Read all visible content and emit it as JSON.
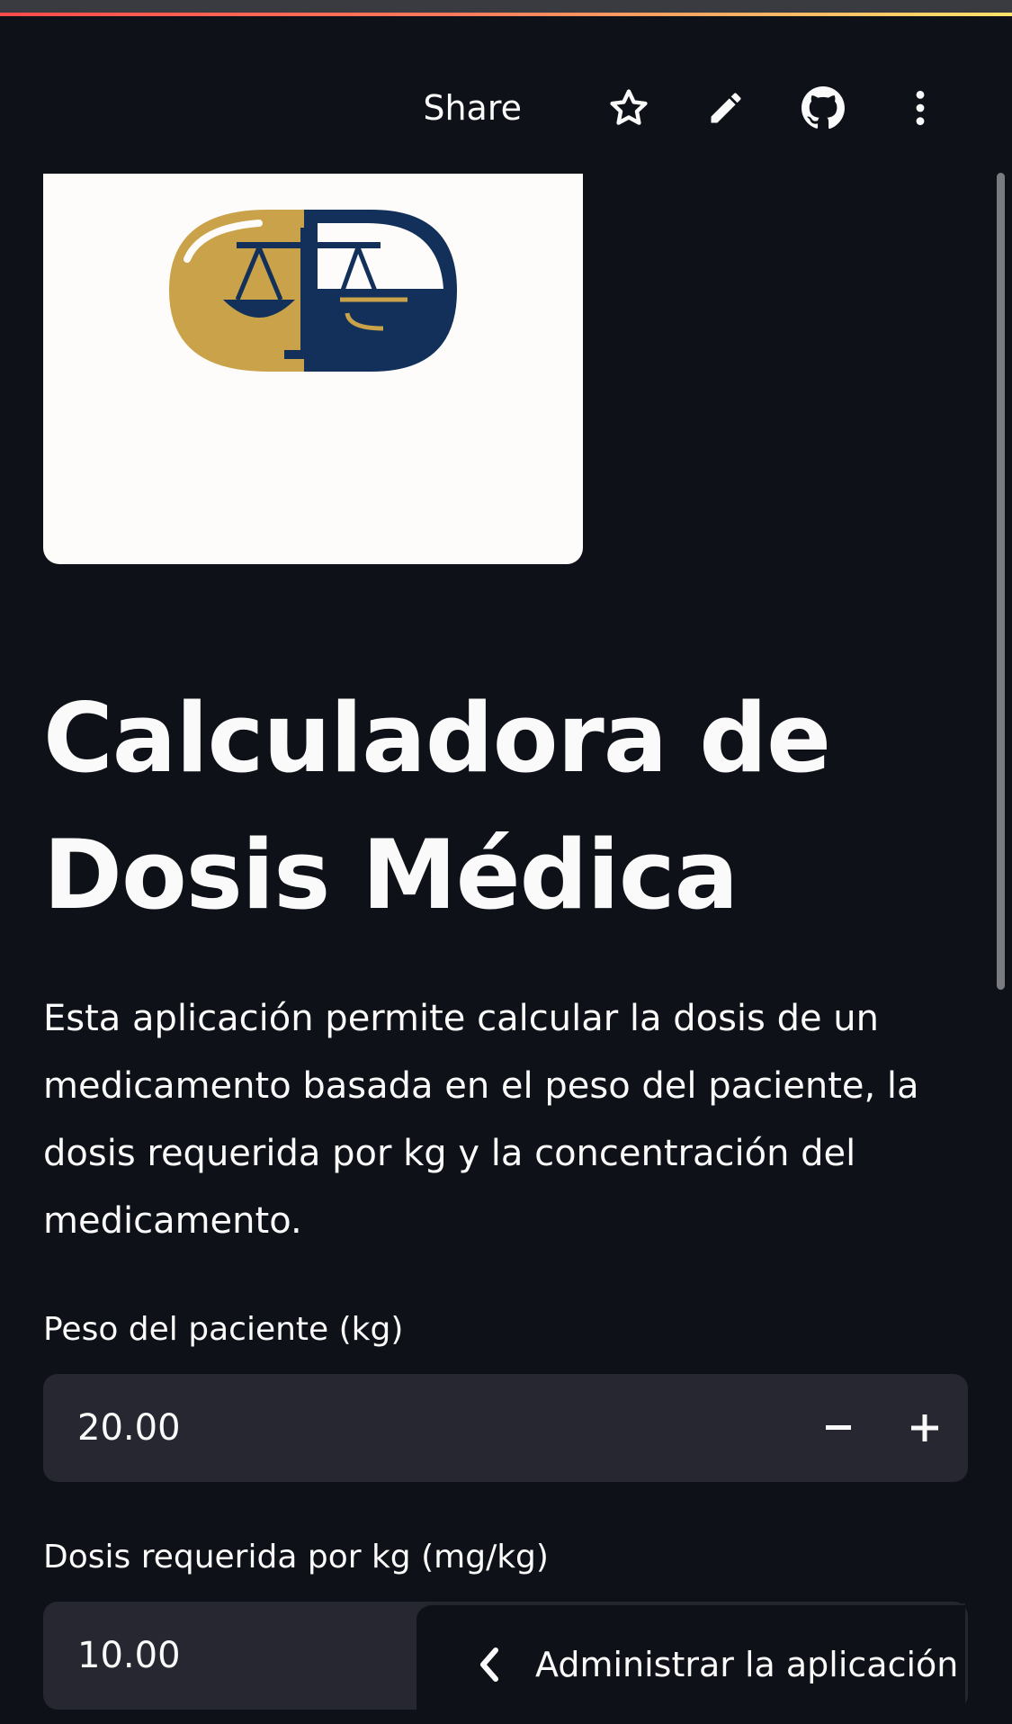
{
  "header": {
    "share_label": "Share",
    "icons": [
      "star-icon",
      "pencil-icon",
      "github-icon",
      "more-vertical-icon"
    ]
  },
  "logo": {
    "alt": "Logo balanza / cápsula",
    "colors": {
      "gold": "#c9a24a",
      "navy": "#12305a"
    }
  },
  "main": {
    "title": "Calculadora de Dosis Médica",
    "description": "Esta aplicación permite calcular la dosis de un medicamento basada en el peso del paciente, la dosis requerida por kg y la concentración del medicamento.",
    "fields": [
      {
        "label": "Peso del paciente (kg)",
        "value": "20.00"
      },
      {
        "label": "Dosis requerida por kg (mg/kg)",
        "value": "10.00"
      }
    ]
  },
  "manage_app": {
    "label": "Administrar la aplicación"
  },
  "colors": {
    "background": "#0e1117",
    "input_bg": "#262730",
    "text": "#fafafa"
  }
}
